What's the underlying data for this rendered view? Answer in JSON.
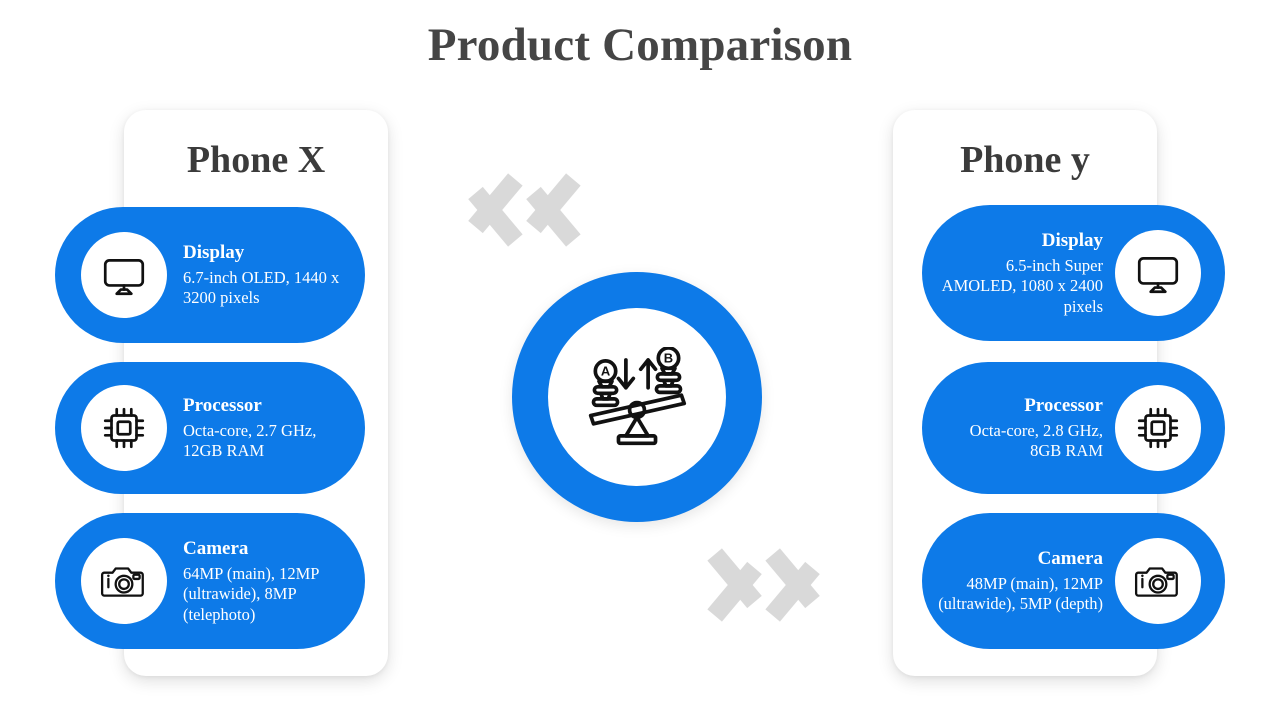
{
  "header": {
    "title": "Product Comparison"
  },
  "center": {
    "emblem_icon": "balance-scale-icon"
  },
  "decorations": {
    "chevron_left_icon": "double-chevron-left-icon",
    "chevron_right_icon": "double-chevron-right-icon",
    "chevron_color": "#d9d9d9"
  },
  "theme": {
    "accent_blue": "#0d7ae8",
    "title_color": "#454545",
    "card_background": "#ffffff",
    "page_background": "#ffffff"
  },
  "columns": [
    {
      "id": "left",
      "title": "Phone X",
      "align": "left",
      "rows": [
        {
          "icon": "monitor-icon",
          "label": "Display",
          "value": " 6.7-inch OLED, 1440 x 3200 pixels"
        },
        {
          "icon": "cpu-chip-icon",
          "label": "Processor",
          "value": "Octa-core, 2.7 GHz, 12GB RAM"
        },
        {
          "icon": "camera-icon",
          "label": "Camera",
          "value": " 64MP (main), 12MP (ultrawide), 8MP (telephoto)"
        }
      ]
    },
    {
      "id": "right",
      "title": "Phone y",
      "align": "right",
      "rows": [
        {
          "icon": "monitor-icon",
          "label": "Display",
          "value": "6.5-inch Super AMOLED, 1080 x 2400 pixels"
        },
        {
          "icon": "cpu-chip-icon",
          "label": "Processor",
          "value": "Octa-core, 2.8 GHz,  8GB RAM"
        },
        {
          "icon": "camera-icon",
          "label": "Camera",
          "value": "48MP (main), 12MP (ultrawide), 5MP (depth)"
        }
      ]
    }
  ]
}
